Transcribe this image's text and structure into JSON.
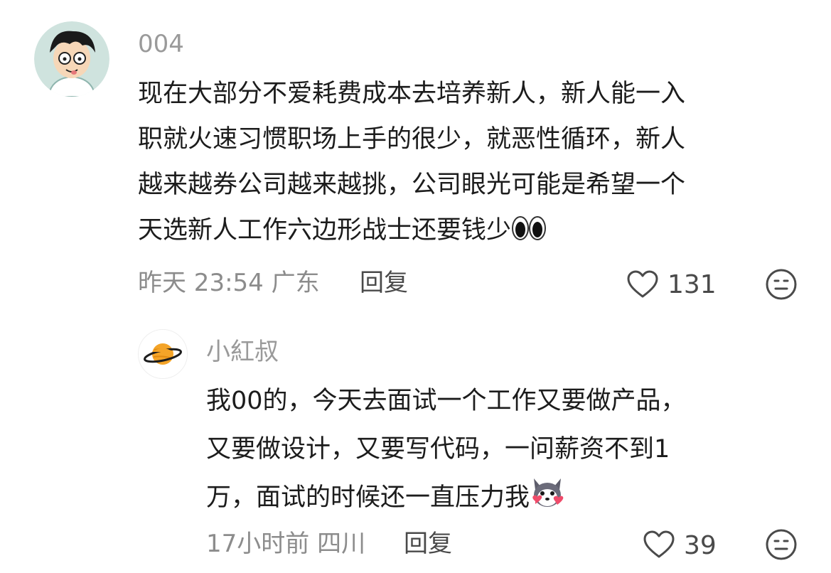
{
  "comment": {
    "username": "004",
    "lines": [
      "现在大部分不爱耗费成本去培养新人，新人能一入",
      "职就火速习惯职场上手的很少，就恶性循环，新人",
      "越来越券公司越来越挑，公司眼光可能是希望一个",
      "天选新人工作六边形战士还要钱少"
    ],
    "meta": "昨天 23:54 广东",
    "reply_label": "回复",
    "likes": "131",
    "avatar_icon": "cartoon-boy-avatar-icon",
    "trailing_emoji": "eyes-emoji-icon"
  },
  "reply": {
    "username": "小紅叔",
    "lines": [
      "我00的，今天去面试一个工作又要做产品，",
      "又要做设计，又要写代码，一问薪资不到1",
      "万，面试的时候还一直压力我"
    ],
    "meta": "17小时前 四川",
    "reply_label": "回复",
    "likes": "39",
    "avatar_icon": "planet-avatar-icon",
    "trailing_emoji": "husky-heart-emoji-icon"
  },
  "colors": {
    "text": "#1c1c1c",
    "muted": "#8c8c8c",
    "icon": "#4a4a4a"
  }
}
